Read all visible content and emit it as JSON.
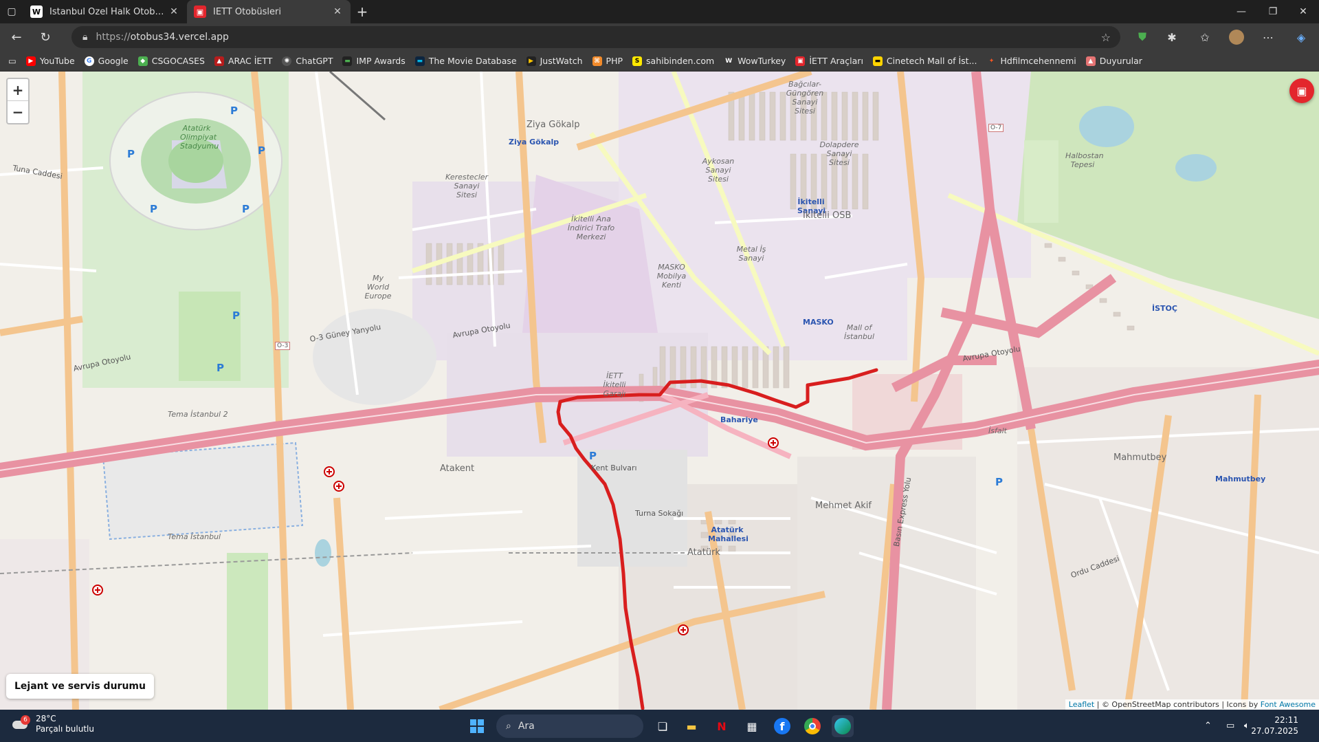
{
  "browser": {
    "tabs": [
      {
        "title": "İstanbul Özel Halk Otobüsleri Sol",
        "favicon": "W",
        "active": false
      },
      {
        "title": "İETT Otobüsleri",
        "favicon": "iett",
        "active": true
      }
    ],
    "address": {
      "prefix": "https://",
      "host": "otobus34.vercel.app"
    },
    "bookmarks": [
      "YouTube",
      "Google",
      "CSGOCASES",
      "ARAC İETT",
      "ChatGPT",
      "IMP Awards",
      "The Movie Database",
      "JustWatch",
      "PHP",
      "sahibinden.com",
      "WowTurkey",
      "İETT Araçları",
      "Cinetech Mall of İst...",
      "Hdfilmcehennemi",
      "Duyurular"
    ]
  },
  "map": {
    "zoom_in": "+",
    "zoom_out": "−",
    "legend_button": "Lejant ve servis durumu",
    "attribution": {
      "leaflet": "Leaflet",
      "osm": "© OpenStreetMap contributors",
      "icons": "Icons by",
      "fa": "Font Awesome"
    },
    "route_color": "#d81e1e",
    "labels": {
      "ziya": "Ziya Gökalp",
      "ziya_stop": "Ziya Gökalp",
      "kerestec": "Kerestecler Sanayi Sitesi",
      "ikitelli_ana": "İkitelli Ana İndirici Trafo Merkezi",
      "aykosan": "Aykosan Sanayi Sitesi",
      "bagcilar": "Bağcılar-Güngören Sanayi Sitesi",
      "dolapdere": "Dolapdere Sanayi Sitesi",
      "ikitelli_osb": "İkitelli OSB",
      "ikitelli_sanayi": "İkitelli Sanayi",
      "metal": "Metal İş Sanayi",
      "masko": "MASKO Mobilya Kenti",
      "masko_stop": "MASKO",
      "mall": "Mall of İstanbul",
      "world_europe": "My World Europe",
      "ataturk_olimpiyat": "Atatürk Olimpiyat Stadyumu",
      "iett_garaj": "İETT İkitelli Garajı",
      "bahariye": "Bahariye",
      "atakent": "Atakent",
      "mahmutbey": "Mahmutbey",
      "mahmutbey_stop": "Mahmutbey",
      "mehmet_akif": "Mehmet Akif",
      "ataturk": "Atatürk",
      "ataturk_mahallesi": "Atatürk Mahallesi",
      "tema": "Tema İstanbul",
      "tema2": "Tema İstanbul 2",
      "halbostan": "Halbostan Tepesi",
      "isfalt": "İsfalt",
      "avrupa1": "Avrupa Otoyolu",
      "avrupa2": "Avrupa Otoyolu",
      "avrupa3": "Avrupa Otoyolu",
      "o3": "O-3",
      "o7": "O-7",
      "guney": "O-3 Güney Yanyolu",
      "basin": "Basın Express Yolu",
      "istoc": "İSTOÇ",
      "kent_bulvari": "Kent Bulvarı",
      "turna": "Turna Sokağı",
      "tuna": "Tuna Caddesi",
      "ordu": "Ordu Caddesi"
    }
  },
  "taskbar": {
    "weather_temp": "28°C",
    "weather_desc": "Parçalı bulutlu",
    "weather_badge": "6",
    "search_placeholder": "Ara",
    "time": "22:11",
    "date": "27.07.2025"
  }
}
